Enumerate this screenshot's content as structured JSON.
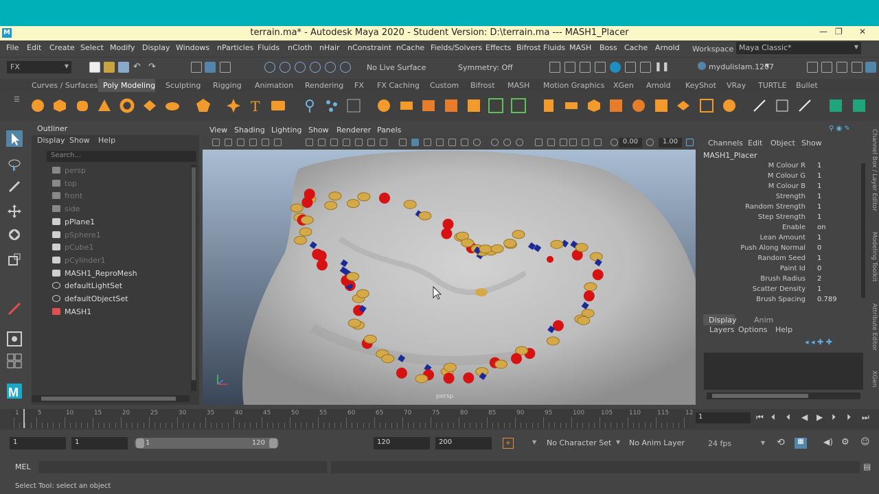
{
  "window": {
    "title": "terrain.ma* - Autodesk Maya 2020 - Student Version: D:\\terrain.ma   ---   MASH1_Placer",
    "app_icon": "M"
  },
  "menu": {
    "items": [
      "File",
      "Edit",
      "Create",
      "Select",
      "Modify",
      "Display",
      "Windows",
      "nParticles",
      "Fluids",
      "nCloth",
      "nHair",
      "nConstraint",
      "nCache",
      "Fields/Solvers",
      "Effects",
      "Bifrost Fluids",
      "MASH",
      "Boss",
      "Cache",
      "Arnold"
    ],
    "workspace_label": "Workspace :",
    "workspace_value": "Maya Classic*"
  },
  "status": {
    "menuset": "FX",
    "live_surface": "No Live Surface",
    "symmetry": "Symmetry: Off",
    "user": "mydulislam.1207"
  },
  "shelf_tabs": [
    "Curves / Surfaces",
    "Poly Modeling",
    "Sculpting",
    "Rigging",
    "Animation",
    "Rendering",
    "FX",
    "FX Caching",
    "Custom",
    "Bifrost",
    "MASH",
    "Motion Graphics",
    "XGen",
    "Arnold",
    "KeyShot",
    "VRay",
    "TURTLE",
    "Bullet"
  ],
  "shelf_active": "Poly Modeling",
  "outliner": {
    "title": "Outliner",
    "menu": [
      "Display",
      "Show",
      "Help"
    ],
    "search_placeholder": "Search...",
    "items": [
      {
        "label": "persp",
        "kind": "camera",
        "dim": true
      },
      {
        "label": "top",
        "kind": "camera",
        "dim": true
      },
      {
        "label": "front",
        "kind": "camera",
        "dim": true
      },
      {
        "label": "side",
        "kind": "camera",
        "dim": true
      },
      {
        "label": "pPlane1",
        "kind": "mesh",
        "dim": false
      },
      {
        "label": "pSphere1",
        "kind": "mesh",
        "dim": true
      },
      {
        "label": "pCube1",
        "kind": "mesh",
        "dim": true
      },
      {
        "label": "pCylinder1",
        "kind": "mesh",
        "dim": true
      },
      {
        "label": "MASH1_ReproMesh",
        "kind": "mesh",
        "dim": false
      },
      {
        "label": "defaultLightSet",
        "kind": "set",
        "dim": false
      },
      {
        "label": "defaultObjectSet",
        "kind": "set",
        "dim": false
      },
      {
        "label": "MASH1",
        "kind": "mash",
        "dim": false
      }
    ]
  },
  "viewport": {
    "menu": [
      "View",
      "Shading",
      "Lighting",
      "Show",
      "Renderer",
      "Panels"
    ],
    "near_value": "0.00",
    "far_value": "1.00",
    "camera_label": "persp"
  },
  "channel_box": {
    "menu": [
      "Channels",
      "Edit",
      "Object",
      "Show"
    ],
    "object": "MASH1_Placer",
    "attributes": [
      {
        "name": "M Colour R",
        "value": "1"
      },
      {
        "name": "M Colour G",
        "value": "1"
      },
      {
        "name": "M Colour B",
        "value": "1"
      },
      {
        "name": "Strength",
        "value": "1"
      },
      {
        "name": "Random Strength",
        "value": "1"
      },
      {
        "name": "Step Strength",
        "value": "1"
      },
      {
        "name": "Enable",
        "value": "on"
      },
      {
        "name": "Lean Amount",
        "value": "1"
      },
      {
        "name": "Push Along Normal",
        "value": "0"
      },
      {
        "name": "Random Seed",
        "value": "1"
      },
      {
        "name": "Paint Id",
        "value": "0"
      },
      {
        "name": "Brush Radius",
        "value": "2"
      },
      {
        "name": "Scatter Density",
        "value": "1"
      },
      {
        "name": "Brush Spacing",
        "value": "0.789"
      }
    ],
    "layer_tabs": [
      "Display",
      "Anim"
    ],
    "layer_menu": [
      "Layers",
      "Options",
      "Help"
    ],
    "side_tabs": [
      "Channel Box / Layer Editor",
      "Modeling Toolkit",
      "Attribute Editor",
      "XGen"
    ]
  },
  "timeline": {
    "ticks": [
      "1",
      "5",
      "10",
      "15",
      "20",
      "25",
      "30",
      "35",
      "40",
      "45",
      "50",
      "55",
      "60",
      "65",
      "70",
      "75",
      "80",
      "85",
      "90",
      "95",
      "100",
      "105",
      "110",
      "115",
      "12"
    ],
    "current_frame": "1"
  },
  "range": {
    "start": "1",
    "playback_start": "1",
    "slider_left": "1",
    "slider_right": "120",
    "playback_end": "120",
    "end": "200",
    "character_set": "No Character Set",
    "anim_layer": "No Anim Layer",
    "fps": "24 fps"
  },
  "command_line": {
    "label": "MEL"
  },
  "help_line": "Select Tool: select an object",
  "colors": {
    "accent": "#5285a6",
    "cyan_band": "#00b0b8",
    "title_bg": "#fbf8c8"
  }
}
